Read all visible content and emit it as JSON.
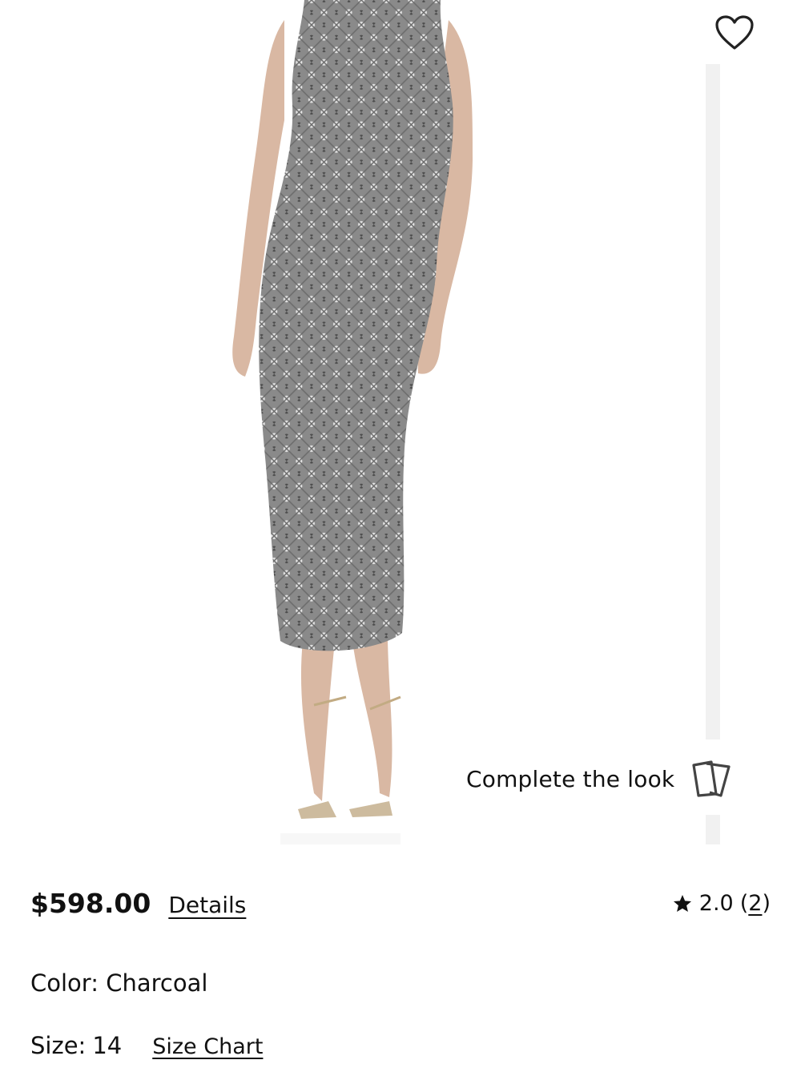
{
  "product": {
    "price": "$598.00",
    "details_label": "Details",
    "rating_value": "2.0",
    "review_count_open": "(",
    "review_count": "2",
    "review_count_close": ")",
    "color_label": "Color:",
    "color_value": "Charcoal",
    "size_label": "Size:",
    "size_value": "14",
    "size_chart_label": "Size Chart"
  },
  "gallery": {
    "complete_look_label": "Complete the look"
  },
  "icons": {
    "wishlist": "heart-outline-icon",
    "complete_look": "cards-icon",
    "rating": "star-icon"
  },
  "colors": {
    "text": "#111111",
    "dress": "#7f7f7f",
    "skin": "#d9b8a3",
    "rail": "#f1f1f1"
  }
}
